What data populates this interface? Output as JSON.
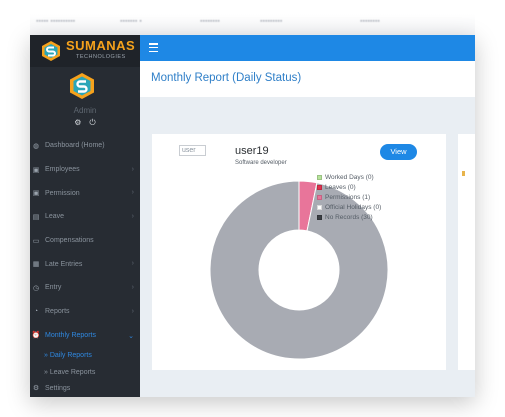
{
  "brand": {
    "name": "SUMANAS",
    "tagline": "TECHNOLOGIES",
    "colors": {
      "orange": "#f6a21c",
      "dark": "#272c33",
      "blue": "#1e88e5"
    }
  },
  "sidebar": {
    "user_name": "Admin",
    "icons": [
      "gear-icon",
      "power-icon"
    ],
    "items": [
      {
        "label": "Dashboard (Home)",
        "icon": "dashboard-icon",
        "has_chevron": false,
        "active": false
      },
      {
        "label": "Employees",
        "icon": "user-icon",
        "has_chevron": true,
        "active": false
      },
      {
        "label": "Permission",
        "icon": "check-icon",
        "has_chevron": true,
        "active": false
      },
      {
        "label": "Leave",
        "icon": "file-icon",
        "has_chevron": true,
        "active": false
      },
      {
        "label": "Compensations",
        "icon": "card-icon",
        "has_chevron": false,
        "active": false
      },
      {
        "label": "Late Entries",
        "icon": "calendar-icon",
        "has_chevron": true,
        "active": false
      },
      {
        "label": "Entry",
        "icon": "clock-icon",
        "has_chevron": true,
        "active": false
      },
      {
        "label": "Reports",
        "icon": "report-icon",
        "has_chevron": true,
        "active": false
      },
      {
        "label": "Monthly Reports",
        "icon": "alarm-icon",
        "has_chevron": true,
        "active": true
      }
    ],
    "submenu": [
      {
        "label": "» Daily Reports",
        "active": true
      },
      {
        "label": "» Leave Reports",
        "active": false
      }
    ],
    "partial_item": "Settings"
  },
  "header": {
    "page_title": "Monthly Report (Daily Status)"
  },
  "card": {
    "image_alt": "user",
    "user_name": "user19",
    "role": "Software developer",
    "view_label": "View"
  },
  "chart_data": {
    "type": "pie",
    "title": "",
    "categories": [
      "Worked Days",
      "Leaves",
      "Permissions",
      "Official Holidays",
      "No Records"
    ],
    "values": [
      0,
      0,
      1,
      0,
      30
    ],
    "legend_labels": [
      "Worked Days (0)",
      "Leaves (0)",
      "Permissions (1)",
      "Official Holidays (0)",
      "No Records (30)"
    ],
    "colors": [
      "#b6e39a",
      "#e0314f",
      "#e8759a",
      "#ffffff",
      "#a8abb3"
    ],
    "legend_swatch_colors": [
      "#b6e39a",
      "#e0314f",
      "#e8759a",
      "#ffffff",
      "#3a3e44"
    ],
    "legend_position": "top-right",
    "donut": true
  }
}
